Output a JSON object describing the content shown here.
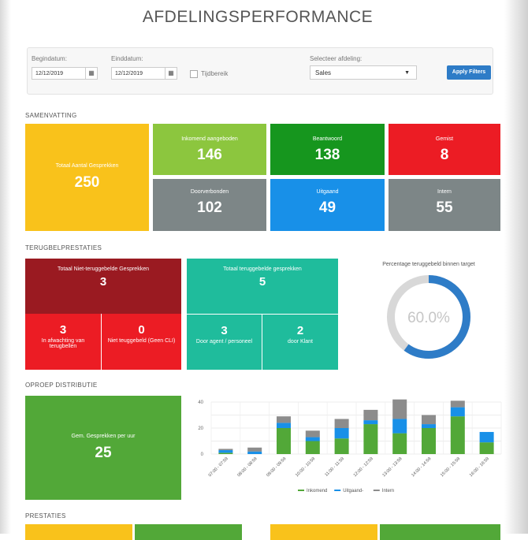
{
  "header": {
    "title": "AFDELINGSPERFORMANCE"
  },
  "filters": {
    "begin_label": "Begindatum:",
    "begin_value": "12/12/2019",
    "end_label": "Einddatum:",
    "end_value": "12/12/2019",
    "timerange_label": "Tijdbereik",
    "department_label": "Selecteer afdeling:",
    "department_value": "Sales",
    "apply_label": "Apply Filters"
  },
  "summary": {
    "heading": "SAMENVATTING",
    "total": {
      "label": "Totaal Aantal Gesprekken",
      "value": "250",
      "color": "#f9c21b"
    },
    "tiles": [
      {
        "label": "Inkomend aangeboden",
        "value": "146",
        "color": "#8cc63e"
      },
      {
        "label": "Beantwoord",
        "value": "138",
        "color": "#16961e"
      },
      {
        "label": "Gemist",
        "value": "8",
        "color": "#ec1c24"
      },
      {
        "label": "Doorverbonden",
        "value": "102",
        "color": "#7d8687"
      },
      {
        "label": "Uitgaand",
        "value": "49",
        "color": "#1890e8"
      },
      {
        "label": "Intern",
        "value": "55",
        "color": "#7d8687"
      }
    ]
  },
  "callback": {
    "heading": "TERUGBELPRESTATIES",
    "not_called": {
      "label": "Totaal Niet-teruggebelde Gesprekken",
      "value": "3",
      "color": "#9a1a21"
    },
    "waiting": {
      "label": "In afwachting van terugbellen",
      "value": "3",
      "color": "#ec1c24"
    },
    "not_called_cli": {
      "label": "Niet teuggebeld (Geen CLI)",
      "value": "0",
      "color": "#ec1c24"
    },
    "called": {
      "label": "Totaal teruggebelde gesprekken",
      "value": "5",
      "color": "#1fbc9c"
    },
    "by_agent": {
      "label": "Door agent / personeel",
      "value": "3",
      "color": "#1fbc9c"
    },
    "by_client": {
      "label": "door Klant",
      "value": "2",
      "color": "#1fbc9c"
    },
    "percentage": {
      "label": "Percentage teruggebeld binnen target",
      "value": "60.0%",
      "fraction": 0.6,
      "color": "#2e7cc7"
    }
  },
  "distribution": {
    "heading": "OPROEP DISTRIBUTIE",
    "avg": {
      "label": "Gem. Gesprekken per uur",
      "value": "25",
      "color": "#52a838"
    }
  },
  "performance": {
    "heading": "PRESTATIES"
  },
  "chart_data": {
    "type": "bar",
    "stacked": true,
    "categories": [
      "07:00 - 07:59",
      "08:00 - 08:59",
      "09:00 - 09:59",
      "10:00 - 10:59",
      "11:00 - 11:59",
      "12:00 - 12:59",
      "13:00 - 13:59",
      "14:00 - 14:59",
      "15:00 - 15:59",
      "16:00 - 16:59"
    ],
    "series": [
      {
        "name": "Inkomend",
        "color": "#52a838",
        "values": [
          1,
          0,
          20,
          10,
          12,
          23,
          16,
          20,
          29,
          9
        ]
      },
      {
        "name": "Uitgaand-",
        "color": "#1890e8",
        "values": [
          2,
          2,
          4,
          3,
          8,
          3,
          11,
          3,
          7,
          8
        ]
      },
      {
        "name": "Intern",
        "color": "#8c8c8c",
        "values": [
          1,
          3,
          5,
          5,
          7,
          8,
          15,
          7,
          5,
          0
        ]
      }
    ],
    "ylim": [
      0,
      40
    ],
    "yticks": [
      0,
      20,
      40
    ],
    "grid": true,
    "legend": "bottom"
  }
}
